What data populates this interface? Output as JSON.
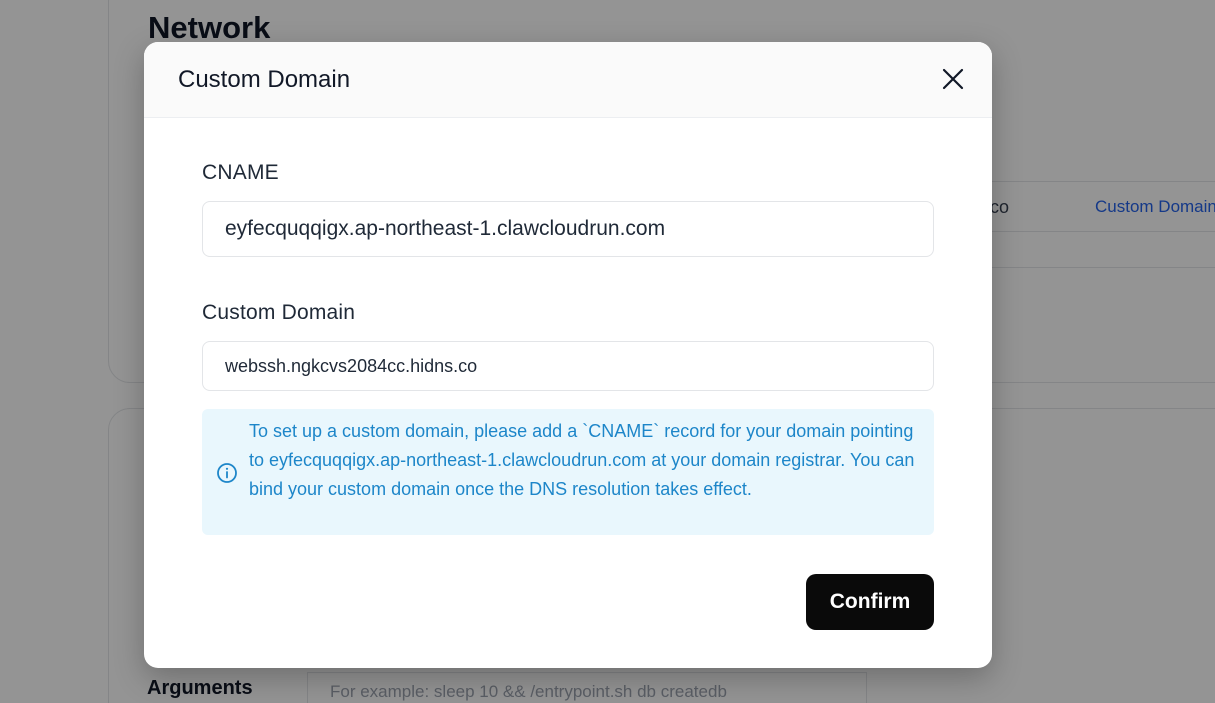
{
  "background": {
    "section_title": "Network",
    "table_cell_partial": "co",
    "table_link": "Custom Domain",
    "args_label": "Arguments",
    "args_placeholder": "For example:  sleep 10 && /entrypoint.sh db createdb"
  },
  "modal": {
    "title": "Custom Domain",
    "close_icon": "close-icon",
    "cname_label": "CNAME",
    "cname_value": "eyfecquqqigx.ap-northeast-1.clawcloudrun.com",
    "domain_label": "Custom Domain",
    "domain_value": "webssh.ngkcvs2084cc.hidns.co",
    "info_icon": "info-icon",
    "info_text": "To set up a custom domain, please add a `CNAME` record for your domain pointing to eyfecquqqigx.ap-northeast-1.clawcloudrun.com at your domain registrar. You can bind your custom domain once the DNS resolution takes effect.",
    "confirm_label": "Confirm"
  },
  "colors": {
    "overlay": "#6b6b6b",
    "info_bg": "#e9f7fd",
    "info_text": "#1d86c9",
    "confirm_bg": "#0a0a0a"
  }
}
